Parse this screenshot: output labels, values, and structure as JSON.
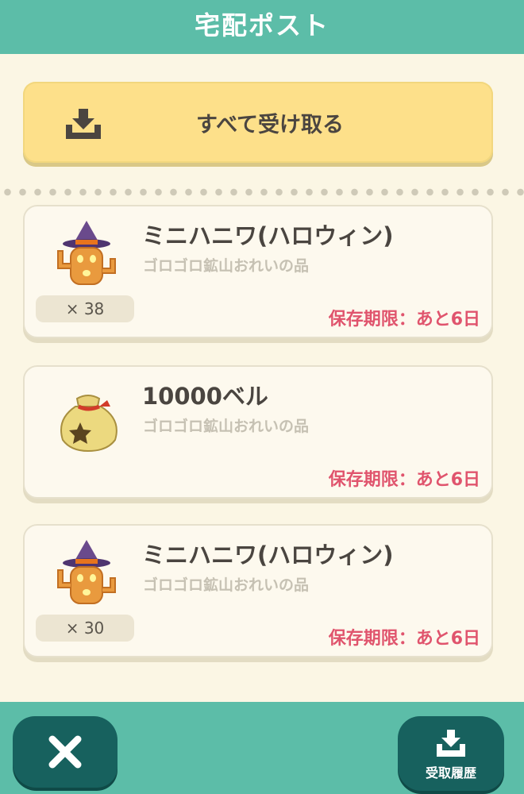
{
  "header": {
    "title": "宅配ポスト"
  },
  "receive_all": {
    "label": "すべて受け取る",
    "icon": "download-tray-icon"
  },
  "items": [
    {
      "name": "ミニハニワ(ハロウィン)",
      "source": "ゴロゴロ鉱山おれいの品",
      "quantity": "× 38",
      "expiry": "保存期限：あと6日",
      "icon": "halloween-haniwa-icon"
    },
    {
      "name": "10000ベル",
      "source": "ゴロゴロ鉱山おれいの品",
      "expiry": "保存期限：あと6日",
      "icon": "bell-bag-icon"
    },
    {
      "name": "ミニハニワ(ハロウィン)",
      "source": "ゴロゴロ鉱山おれいの品",
      "quantity": "× 30",
      "expiry": "保存期限：あと6日",
      "icon": "halloween-haniwa-icon"
    }
  ],
  "footer": {
    "close_icon": "close-icon",
    "history_label": "受取履歴",
    "history_icon": "download-tray-icon"
  },
  "colors": {
    "header_bg": "#5cbda8",
    "page_bg": "#fbf6e4",
    "button_yellow": "#fde08a",
    "expiry_red": "#e0546d",
    "footer_button": "#17615e"
  }
}
